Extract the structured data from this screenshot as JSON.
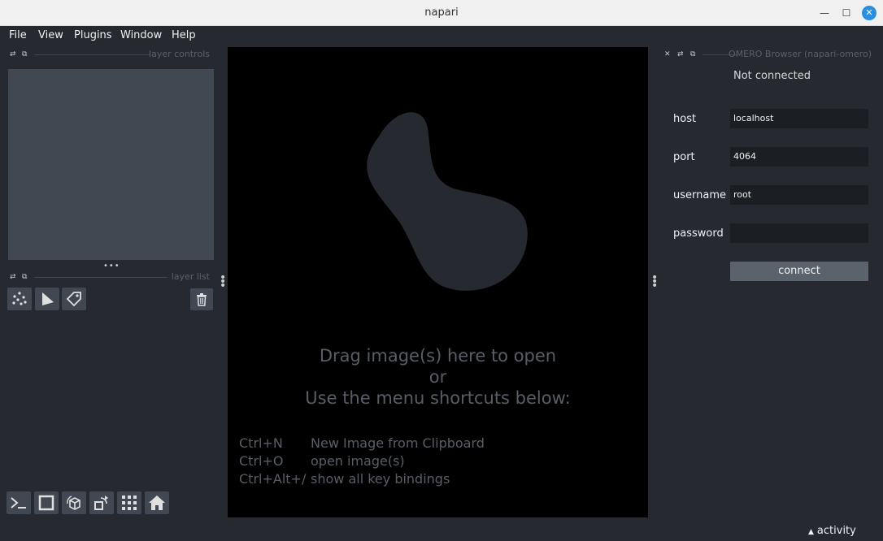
{
  "window": {
    "title": "napari",
    "minimize_glyph": "—",
    "maximize_glyph": "☐",
    "close_glyph": "✕"
  },
  "menubar": {
    "items": [
      "File",
      "View",
      "Plugins",
      "Window",
      "Help"
    ]
  },
  "layer_controls": {
    "title": "layer controls"
  },
  "layer_list": {
    "title": "layer list"
  },
  "layer_buttons": [
    "new-points-layer",
    "new-shapes-layer",
    "new-labels-layer",
    "delete-layer"
  ],
  "viewer_buttons": [
    "console",
    "toggle-ndisplay",
    "roll-dims",
    "transpose-dims",
    "grid-view",
    "reset-view"
  ],
  "canvas": {
    "welcome_line1": "Drag image(s) here to open",
    "welcome_line2": "or",
    "welcome_line3": "Use the menu shortcuts below:",
    "shortcuts": [
      {
        "key": "Ctrl+N",
        "desc": "New Image from Clipboard"
      },
      {
        "key": "Ctrl+O",
        "desc": "open image(s)"
      },
      {
        "key": "Ctrl+Alt+/",
        "desc": "show all key bindings"
      }
    ]
  },
  "omero": {
    "title": "OMERO Browser (napari-omero)",
    "status": "Not connected",
    "fields": [
      {
        "label": "host",
        "value": "localhost"
      },
      {
        "label": "port",
        "value": "4064"
      },
      {
        "label": "username",
        "value": "root"
      },
      {
        "label": "password",
        "value": ""
      }
    ],
    "connect_label": "connect"
  },
  "statusbar": {
    "activity_label": "activity"
  },
  "colors": {
    "background": "#262930",
    "panel": "#414851",
    "canvas": "#000000",
    "accent_close": "#2a8fe0"
  }
}
